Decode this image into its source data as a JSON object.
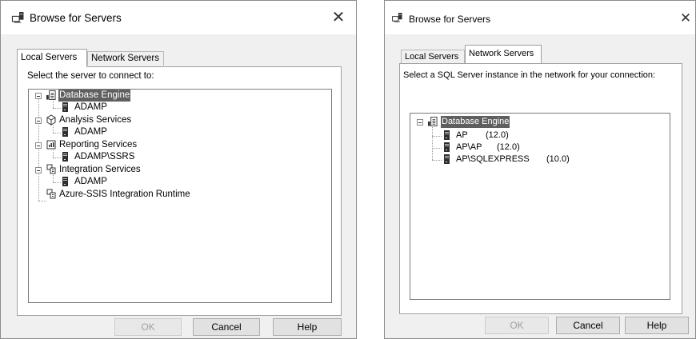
{
  "left_dialog": {
    "title": "Browse for Servers",
    "tabs": [
      {
        "label": "Local Servers",
        "active": true
      },
      {
        "label": "Network Servers",
        "active": false
      }
    ],
    "prompt": "Select the server to connect to:",
    "tree": [
      {
        "label": "Database Engine",
        "icon": "database-engine-icon",
        "selected": true,
        "children": [
          {
            "label": "ADAMP",
            "icon": "server-icon"
          }
        ]
      },
      {
        "label": "Analysis Services",
        "icon": "cube-icon",
        "children": [
          {
            "label": "ADAMP",
            "icon": "server-icon"
          }
        ]
      },
      {
        "label": "Reporting Services",
        "icon": "report-icon",
        "children": [
          {
            "label": "ADAMP\\SSRS",
            "icon": "server-icon"
          }
        ]
      },
      {
        "label": "Integration Services",
        "icon": "package-icon",
        "children": [
          {
            "label": "ADAMP",
            "icon": "server-icon"
          }
        ]
      },
      {
        "label": "Azure-SSIS Integration Runtime",
        "icon": "package-icon",
        "children": []
      }
    ],
    "buttons": {
      "ok": "OK",
      "cancel": "Cancel",
      "help": "Help"
    }
  },
  "right_dialog": {
    "title": "Browse for Servers",
    "tabs": [
      {
        "label": "Local Servers",
        "active": false
      },
      {
        "label": "Network Servers",
        "active": true
      }
    ],
    "prompt": "Select a SQL Server instance in the network for your connection:",
    "tree": {
      "root": {
        "label": "Database Engine",
        "icon": "database-engine-icon",
        "selected": true
      },
      "children": [
        {
          "label": "AP",
          "version": "(12.0)",
          "icon": "server-icon"
        },
        {
          "label": "AP\\AP",
          "version": "(12.0)",
          "icon": "server-icon"
        },
        {
          "label": "AP\\SQLEXPRESS",
          "version": "(10.0)",
          "icon": "server-icon"
        }
      ]
    },
    "buttons": {
      "ok": "OK",
      "cancel": "Cancel",
      "help": "Help"
    }
  }
}
